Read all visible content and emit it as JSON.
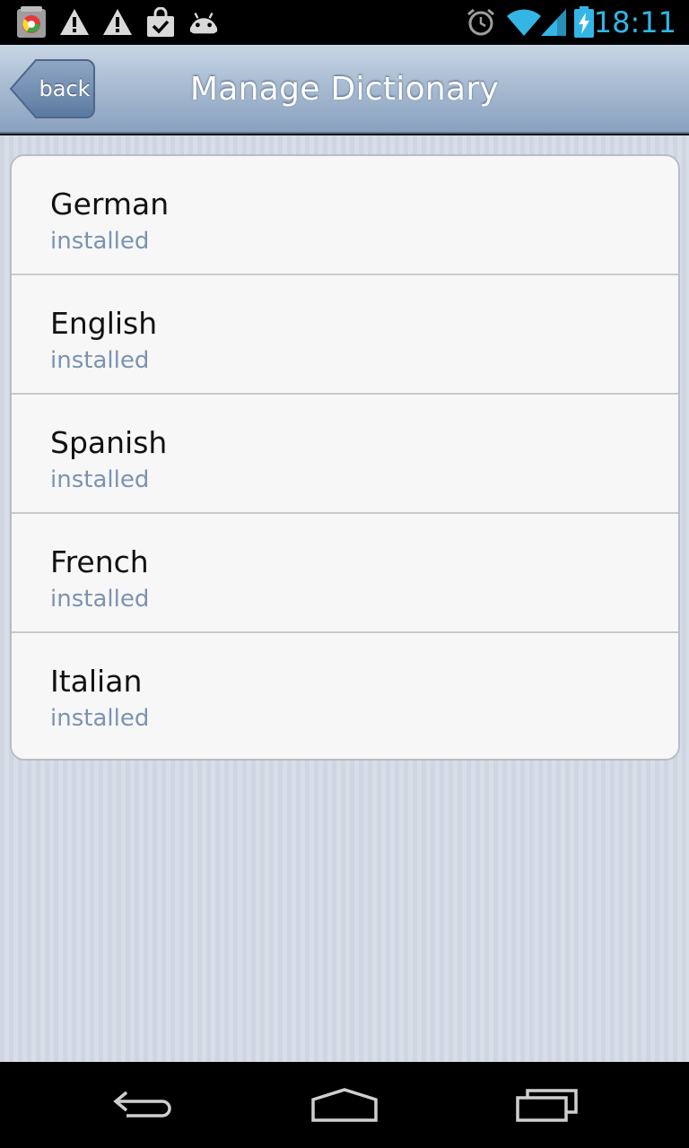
{
  "status_bar": {
    "time": "18:11",
    "notification_icons": [
      "app-icon",
      "warning-icon",
      "warning-icon",
      "shopping-bag-icon",
      "android-icon"
    ],
    "system_icons": [
      "alarm-icon",
      "wifi-icon",
      "signal-icon",
      "battery-charging-icon"
    ]
  },
  "header": {
    "back_label": "back",
    "title": "Manage Dictionary"
  },
  "dictionaries": [
    {
      "name": "German",
      "status": "installed"
    },
    {
      "name": "English",
      "status": "installed"
    },
    {
      "name": "Spanish",
      "status": "installed"
    },
    {
      "name": "French",
      "status": "installed"
    },
    {
      "name": "Italian",
      "status": "installed"
    }
  ],
  "nav_bar": {
    "buttons": [
      "back-nav-icon",
      "home-nav-icon",
      "recent-apps-icon"
    ]
  },
  "colors": {
    "clock": "#33b5e5",
    "status_text": "#7b93b2",
    "header_gradient_top": "#c9d7e6",
    "header_gradient_bottom": "#8aa2bf"
  }
}
